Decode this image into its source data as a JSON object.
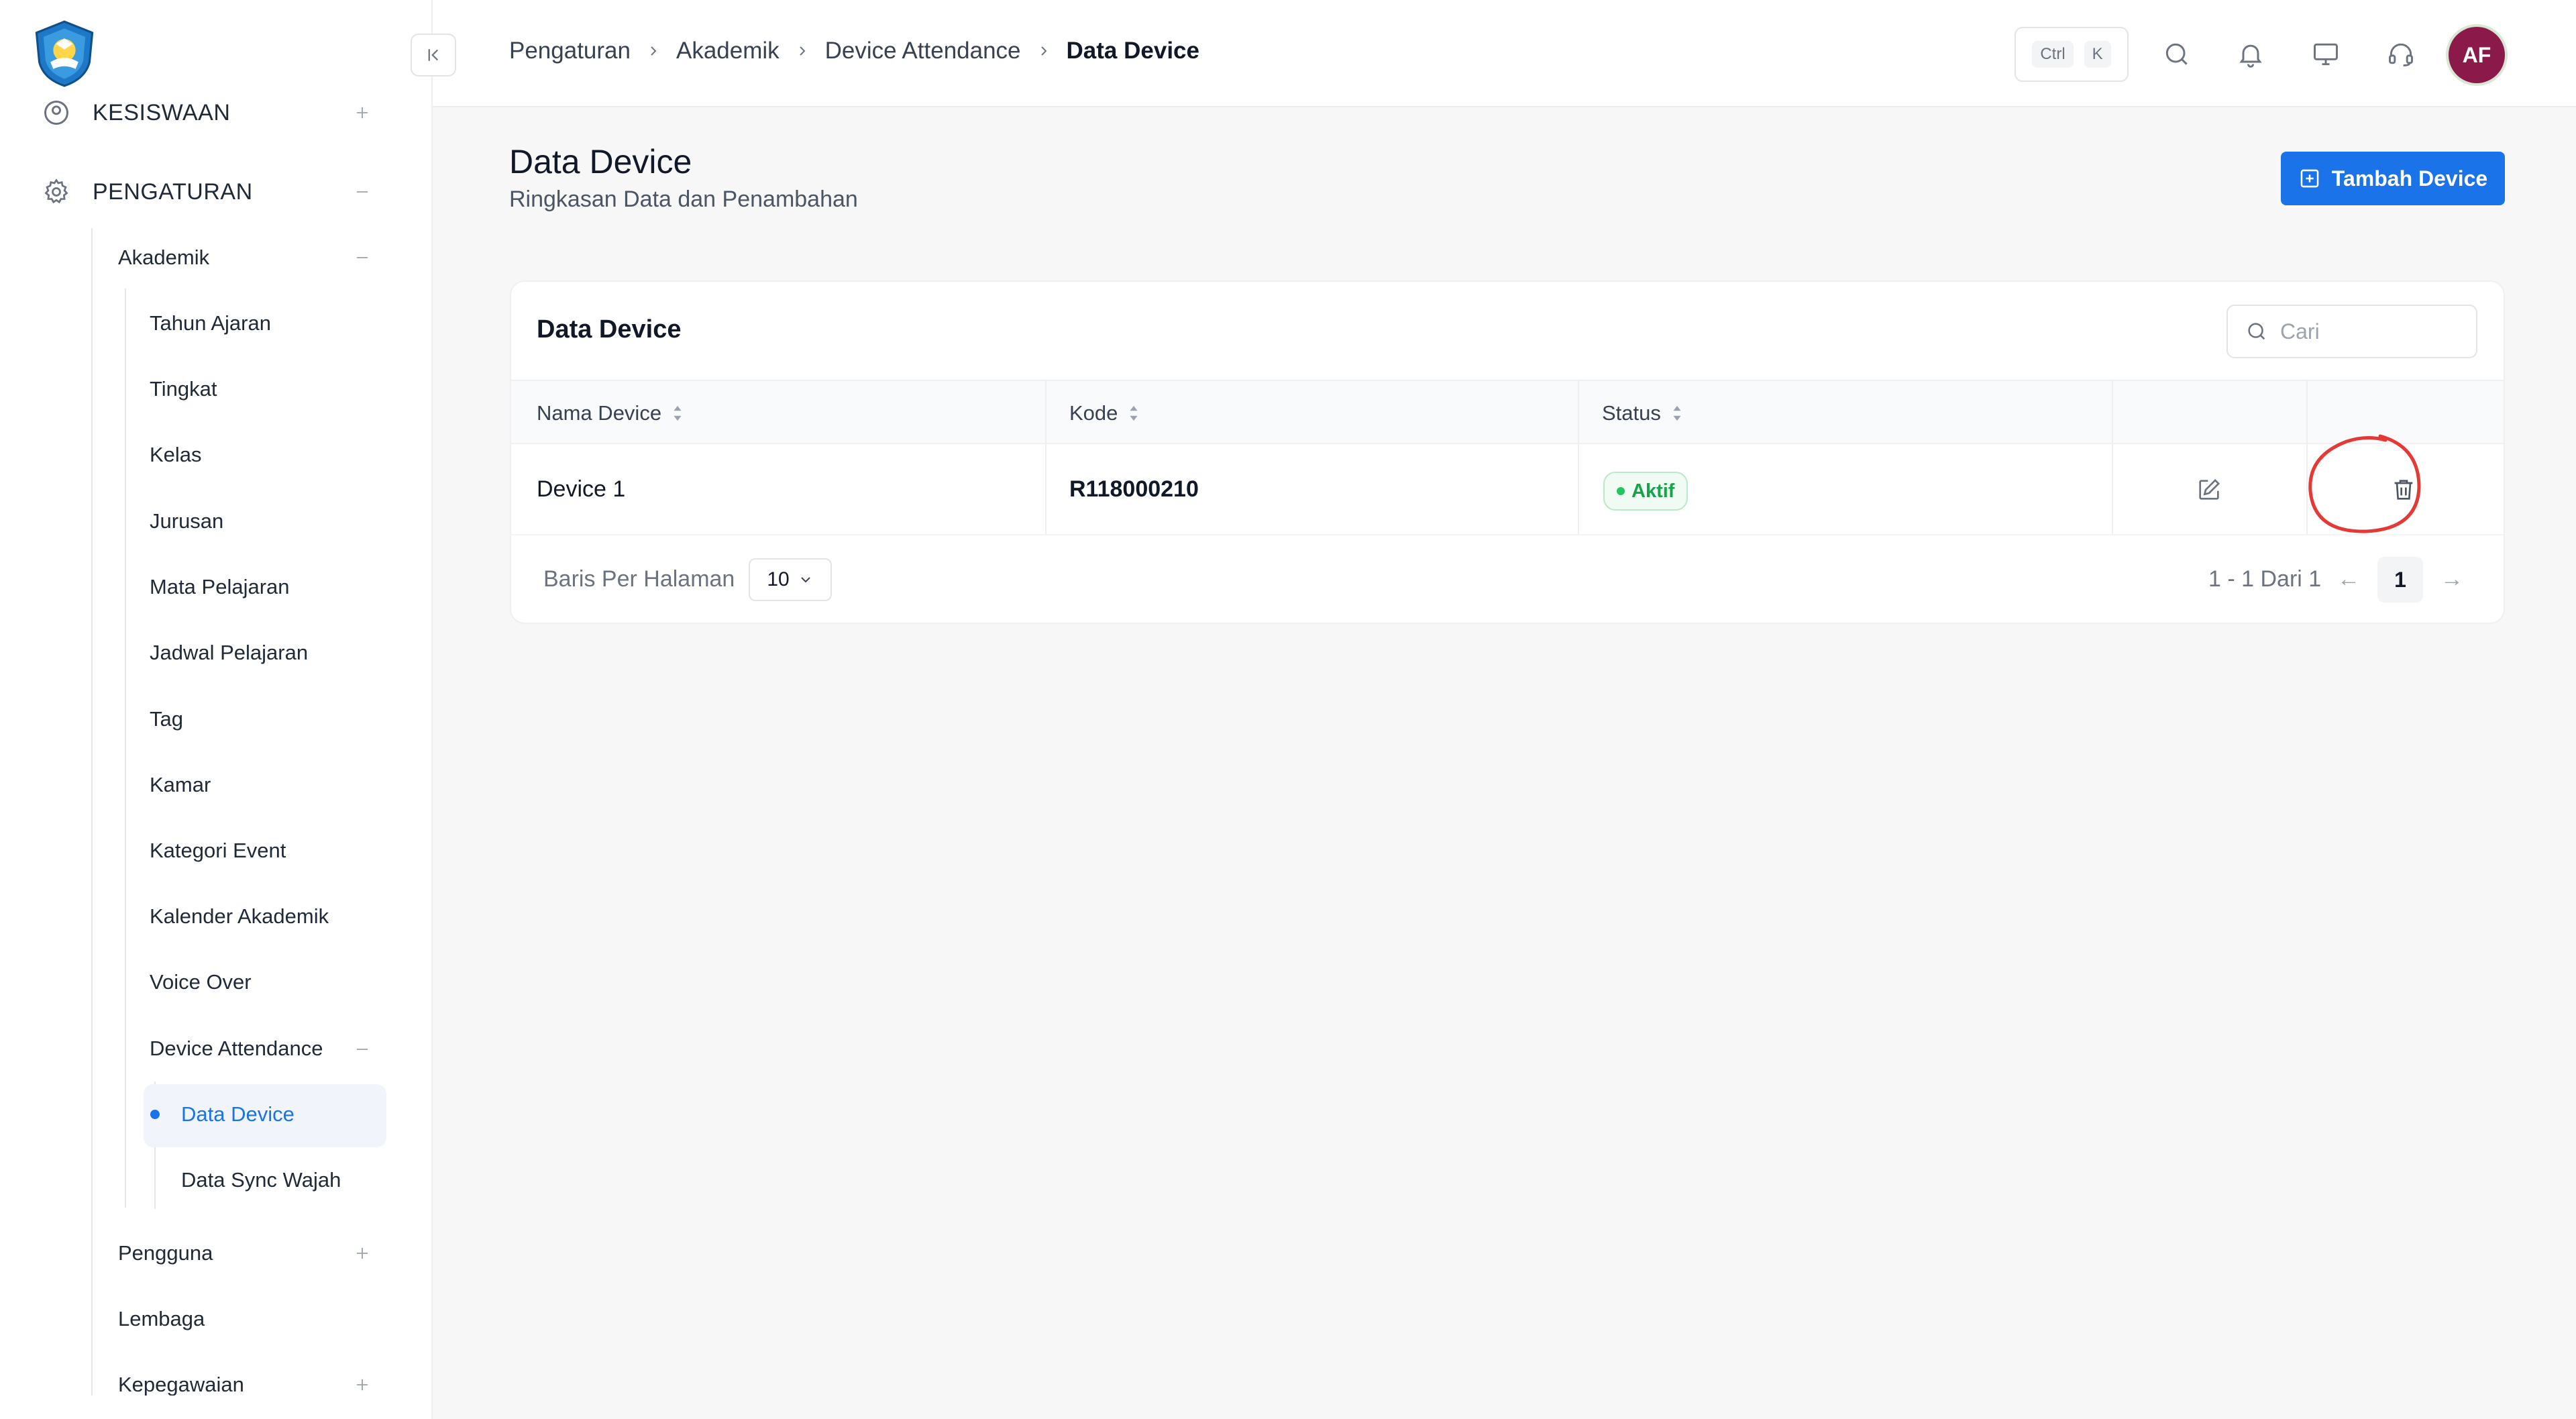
{
  "sidebar": {
    "sections": [
      {
        "label": "KESISWAAN",
        "toggle": "+"
      },
      {
        "label": "PENGATURAN",
        "toggle": "-"
      }
    ],
    "akademik": {
      "label": "Akademik",
      "toggle": "-"
    },
    "akademik_items": [
      "Tahun Ajaran",
      "Tingkat",
      "Kelas",
      "Jurusan",
      "Mata Pelajaran",
      "Jadwal Pelajaran",
      "Tag",
      "Kamar",
      "Kategori Event",
      "Kalender Akademik",
      "Voice Over"
    ],
    "device_attendance": {
      "label": "Device Attendance",
      "toggle": "-"
    },
    "device_items": [
      {
        "label": "Data Device",
        "active": true
      },
      {
        "label": "Data Sync Wajah",
        "active": false
      }
    ],
    "other_groups": [
      {
        "label": "Pengguna",
        "toggle": "+"
      },
      {
        "label": "Lembaga",
        "toggle": ""
      },
      {
        "label": "Kepegawaian",
        "toggle": "+"
      }
    ]
  },
  "header": {
    "breadcrumb": [
      "Pengaturan",
      "Akademik",
      "Device Attendance",
      "Data Device"
    ],
    "shortcut": [
      "Ctrl",
      "K"
    ],
    "icons": [
      "search-icon",
      "bell-icon",
      "monitor-icon",
      "headset-icon"
    ],
    "avatar_initials": "AF"
  },
  "page": {
    "title": "Data Device",
    "subtitle": "Ringkasan Data dan Penambahan",
    "add_button": "Tambah Device"
  },
  "table": {
    "title": "Data Device",
    "search_placeholder": "Cari",
    "columns": [
      "Nama Device",
      "Kode",
      "Status"
    ],
    "rows": [
      {
        "name": "Device 1",
        "code": "R118000210",
        "status": "Aktif"
      }
    ],
    "footer": {
      "per_page_label": "Baris Per Halaman",
      "per_page_value": "10",
      "range": "1 - 1 Dari 1",
      "current_page": "1",
      "prev": "←",
      "next": "→"
    }
  },
  "colors": {
    "primary": "#1a73e8",
    "status_active": "#16a34a",
    "annotation": "#e53935",
    "avatar": "#8b1a4a"
  }
}
